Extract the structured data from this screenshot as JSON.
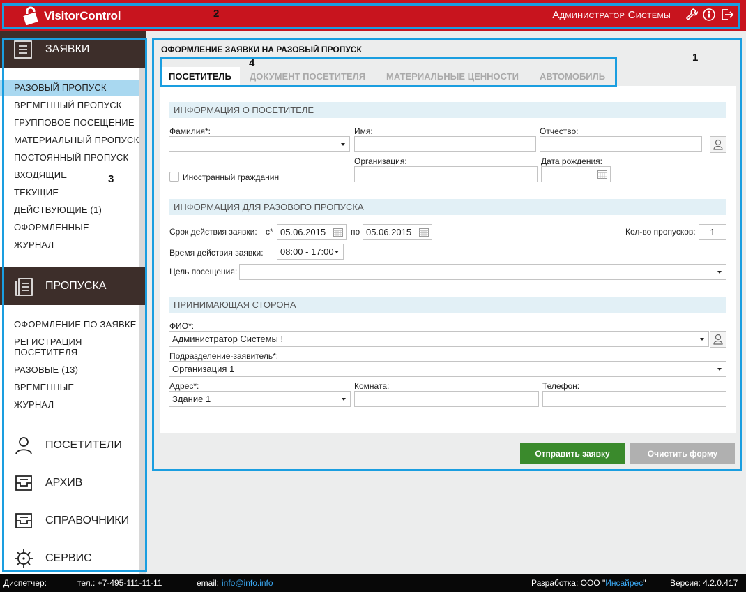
{
  "header": {
    "app_title": "VisitorControl",
    "user_name": "Администратор Системы"
  },
  "annotations": {
    "a1": "1",
    "a2": "2",
    "a3": "3",
    "a4": "4"
  },
  "sidebar": {
    "requests_title": "ЗАЯВКИ",
    "requests_items": [
      "РАЗОВЫЙ ПРОПУСК",
      "ВРЕМЕННЫЙ ПРОПУСК",
      "ГРУППОВОЕ ПОСЕЩЕНИЕ",
      "МАТЕРИАЛЬНЫЙ ПРОПУСК",
      "ПОСТОЯННЫЙ ПРОПУСК",
      "ВХОДЯЩИЕ",
      "ТЕКУЩИЕ",
      "ДЕЙСТВУЮЩИЕ (1)",
      "ОФОРМЛЕННЫЕ",
      "ЖУРНАЛ"
    ],
    "passes_title": "ПРОПУСКА",
    "passes_items": [
      "ОФОРМЛЕНИЕ ПО ЗАЯВКЕ",
      "РЕГИСТРАЦИЯ",
      "ПОСЕТИТЕЛЯ",
      "РАЗОВЫЕ (13)",
      "ВРЕМЕННЫЕ",
      "ЖУРНАЛ"
    ],
    "bottom_items": [
      "ПОСЕТИТЕЛИ",
      "АРХИВ",
      "СПРАВОЧНИКИ",
      "СЕРВИС"
    ]
  },
  "main": {
    "page_title": "ОФОРМЛЕНИЕ ЗАЯВКИ НА РАЗОВЫЙ ПРОПУСК",
    "tabs": [
      "ПОСЕТИТЕЛЬ",
      "ДОКУМЕНТ ПОСЕТИТЕЛЯ",
      "МАТЕРИАЛЬНЫЕ ЦЕННОСТИ",
      "АВТОМОБИЛЬ"
    ],
    "visitor_section": "ИНФОРМАЦИЯ О ПОСЕТИТЕЛЕ",
    "labels": {
      "surname": "Фамилия*:",
      "name": "Имя:",
      "patronymic": "Отчество:",
      "organization": "Организация:",
      "birth_date": "Дата рождения:",
      "foreigner": "Иностранный гражданин"
    },
    "pass_section": "ИНФОРМАЦИЯ ДЛЯ РАЗОВОГО ПРОПУСКА",
    "pass": {
      "validity_label": "Срок действия заявки:",
      "from_label": "с*",
      "from_value": "05.06.2015",
      "to_label": "по",
      "to_value": "05.06.2015",
      "count_label": "Кол-во пропусков:",
      "count_value": "1",
      "time_label": "Время действия заявки:",
      "time_value": "08:00 - 17:00",
      "purpose_label": "Цель посещения:"
    },
    "host_section": "ПРИНИМАЮЩАЯ СТОРОНА",
    "host": {
      "fio_label": "ФИО*:",
      "fio_value": "Администратор Системы !",
      "dept_label": "Подразделение-заявитель*:",
      "dept_value": "Организация 1",
      "address_label": "Адрес*:",
      "address_value": "Здание 1",
      "room_label": "Комната:",
      "phone_label": "Телефон:"
    },
    "submit_label": "Отправить заявку",
    "clear_label": "Очистить форму",
    "colors": {
      "accent": "#c8141e",
      "submit": "#3a8a2c",
      "clear": "#b0b0b0",
      "highlight": "#1a9ee0"
    }
  },
  "footer": {
    "dispatcher": "Диспетчер:",
    "phone": "тел.: +7-495-111-11-11",
    "email_label": "email:",
    "email": "info@info.info",
    "dev_prefix": "Разработка: ООО \"",
    "dev_company": "Инсайрес",
    "dev_suffix": "\"",
    "version": "Версия: 4.2.0.417"
  }
}
